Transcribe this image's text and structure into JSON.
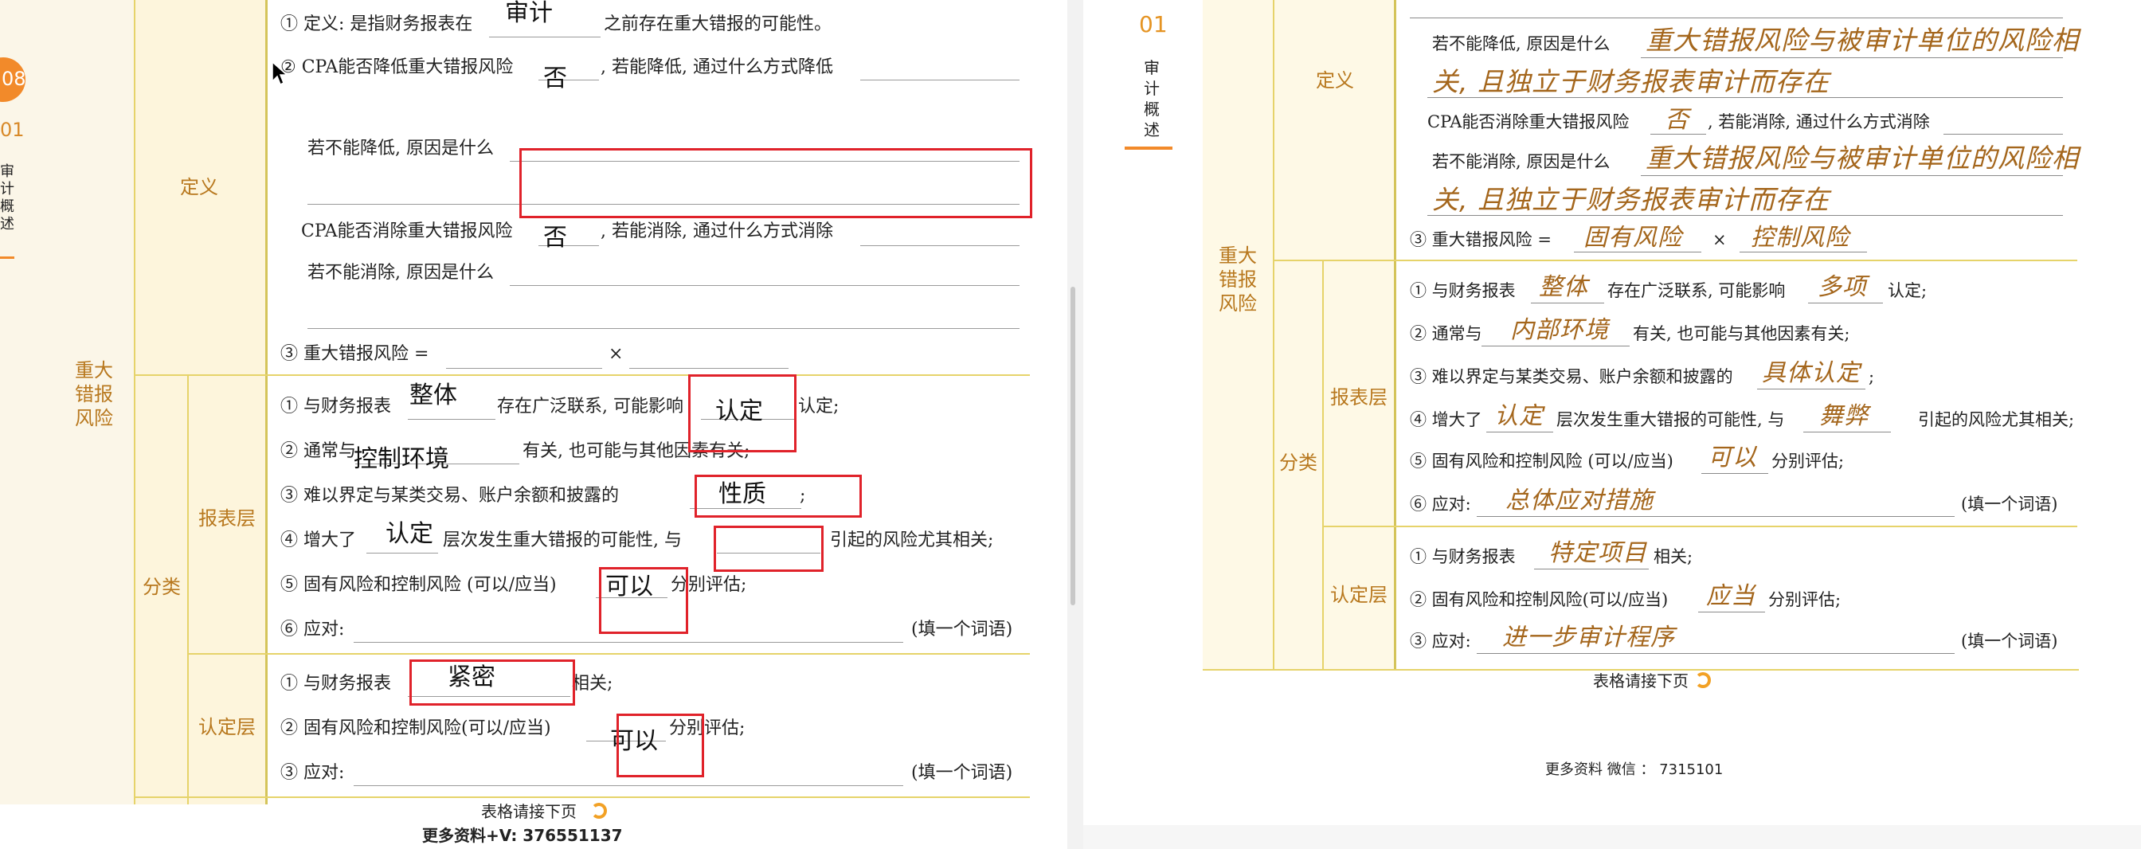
{
  "left_page": {
    "page_number": "08",
    "chapter_number": "01",
    "chapter_title": "审计概述",
    "categories": {
      "main": "重大错报风险",
      "definition": "定义",
      "classification": "分类",
      "statement_level": "报表层",
      "assertion_level": "认定层"
    },
    "definition_lines": {
      "def_prefix": "① 定义: 是指财务报表在",
      "def_suffix": "之前存在重大错报的可能性。",
      "can_reduce_prefix": "② CPA能否降低重大错报风险",
      "can_reduce_suffix": ", 若能降低, 通过什么方式降低",
      "reason_not_reduce": "若不能降低, 原因是什么",
      "can_eliminate_prefix": "CPA能否消除重大错报风险",
      "can_eliminate_suffix": ", 若能消除, 通过什么方式消除",
      "reason_not_eliminate": "若不能消除, 原因是什么",
      "risk_formula_prefix": "③ 重大错报风险 =",
      "times": "×"
    },
    "statement_lines": {
      "l1_prefix": "① 与财务报表",
      "l1_mid": "存在广泛联系, 可能影响",
      "l1_suffix": "认定;",
      "l2_prefix": "② 通常与",
      "l2_suffix": "有关, 也可能与其他因素有关;",
      "l3_prefix": "③ 难以界定与某类交易、账户余额和披露的",
      "l3_suffix": ";",
      "l4_prefix": "④ 增大了",
      "l4_mid": "层次发生重大错报的可能性, 与",
      "l4_suffix": "引起的风险尤其相关;",
      "l5_prefix": "⑤ 固有风险和控制风险 (可以/应当)",
      "l5_suffix": "分别评估;",
      "l6_prefix": "⑥ 应对:",
      "l6_hint": "(填一个词语)"
    },
    "assertion_lines": {
      "a1_prefix": "① 与财务报表",
      "a1_suffix": "相关;",
      "a2_prefix": "② 固有风险和控制风险(可以/应当)",
      "a2_suffix": "分别评估;",
      "a3_prefix": "③ 应对:",
      "a3_hint": "(填一个词语)"
    },
    "answers": {
      "audit": "审计",
      "no_reduce": "否",
      "no_eliminate": "否",
      "whole": "整体",
      "assertion1": "认定",
      "control_env": "控制环境",
      "nature": "性质",
      "assertion2": "认定",
      "can1": "可以",
      "close": "紧密",
      "can2": "可以"
    },
    "footer_continue": "表格请接下页",
    "footer_contact": "更多资料+V:  376551137"
  },
  "right_page": {
    "chapter_number": "01",
    "chapter_title": "审计概述",
    "categories": {
      "main": "重大错报风险",
      "definition": "定义",
      "classification": "分类",
      "statement_level": "报表层",
      "assertion_level": "认定层"
    },
    "lines": {
      "reason_not_reduce": "若不能降低, 原因是什么",
      "can_eliminate_prefix": "CPA能否消除重大错报风险",
      "can_eliminate_suffix": ", 若能消除, 通过什么方式消除",
      "reason_not_eliminate": "若不能消除, 原因是什么",
      "risk_formula_prefix": "③ 重大错报风险 =",
      "times": "×",
      "s1_prefix": "① 与财务报表",
      "s1_mid": "存在广泛联系, 可能影响",
      "s1_suffix": "认定;",
      "s2_prefix": "② 通常与",
      "s2_suffix": "有关, 也可能与其他因素有关;",
      "s3_prefix": "③ 难以界定与某类交易、账户余额和披露的",
      "s3_suffix": ";",
      "s4_prefix": "④ 增大了",
      "s4_mid": "层次发生重大错报的可能性, 与",
      "s4_suffix": "引起的风险尤其相关;",
      "s5_prefix": "⑤ 固有风险和控制风险 (可以/应当)",
      "s5_suffix": "分别评估;",
      "s6_prefix": "⑥ 应对:",
      "s6_hint": "(填一个词语)",
      "a1_prefix": "① 与财务报表",
      "a1_suffix": "相关;",
      "a2_prefix": "② 固有风险和控制风险(可以/应当)",
      "a2_suffix": "分别评估;",
      "a3_prefix": "③ 应对:",
      "a3_hint": "(填一个词语)"
    },
    "answers": {
      "reason1_line1": "重大错报风险与被审计单位的风险相",
      "reason1_line2": "关, 且独立于财务报表审计而存在",
      "no": "否",
      "reason2_line1": "重大错报风险与被审计单位的风险相",
      "reason2_line2": "关, 且独立于财务报表审计而存在",
      "inherent": "固有风险",
      "control": "控制风险",
      "whole": "整体",
      "multiple": "多项",
      "internal_env": "内部环境",
      "specific": "具体认定",
      "assertion": "认定",
      "fraud": "舞弊",
      "can": "可以",
      "overall_response": "总体应对措施",
      "specific_item": "特定项目",
      "should": "应当",
      "further_procedures": "进一步审计程序"
    },
    "footer_continue": "表格请接下页",
    "footer_contact": "更多资料  微信 ： 7315101"
  }
}
